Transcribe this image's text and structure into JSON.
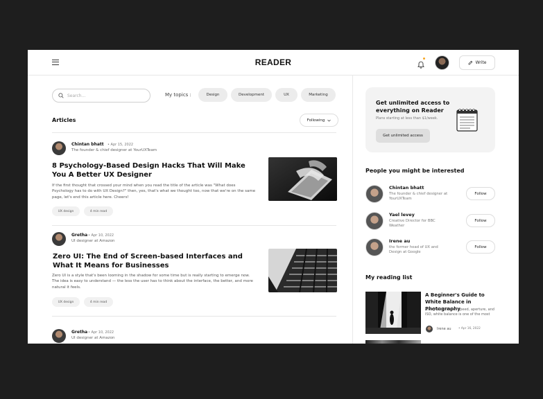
{
  "app": {
    "logo": "READER",
    "write_label": "Write"
  },
  "search": {
    "placeholder": "Search..."
  },
  "topics": {
    "label": "My topics :",
    "items": [
      "Design",
      "Development",
      "UX",
      "Marketing"
    ]
  },
  "articles_section": {
    "title": "Articles",
    "filter_label": "Following"
  },
  "articles": [
    {
      "author": "Chintan bhatt",
      "date": "Apr 15, 2022",
      "role": "The founder & chief designer at YourUXTeam",
      "title": "8 Psychology-Based Design Hacks That Will Make You A Better UX Designer",
      "excerpt": "If the first thought that crossed your mind when you read the title of the article was \"What does Psychology has to do with UX Design?\" then, yes, that's what we thought too, now that we're on the same page, let's end this article here. Cheers!",
      "tag": "UX design",
      "read_time": "4 min read"
    },
    {
      "author": "Gretha",
      "date": "Apr 10, 2022",
      "role": "UI designer at Amazon",
      "title": "Zero UI: The End of Screen-based Interfaces and What It Means for Businesses",
      "excerpt": "Zero UI is a style that's been looming in the shadow for some time but is really starting to emerge now. The idea is easy to understand — the less the user has to think about the interface, the better, and more natural it feels.",
      "tag": "UX design",
      "read_time": "4 min read"
    },
    {
      "author": "Gretha",
      "date": "Apr 10, 2022",
      "role": "UI designer at Amazon"
    }
  ],
  "promo": {
    "title": "Get unlimited access to everything on Reader",
    "subtitle": "Plans starting at less than $1/week.",
    "button": "Get unlimited access"
  },
  "people": {
    "title": "People you might be interested",
    "follow_label": "Follow",
    "items": [
      {
        "name": "Chintan bhatt",
        "desc": "The founder & chief designer at YourUXTeam"
      },
      {
        "name": "Yael levey",
        "desc": "Creative Director for BBC Weather"
      },
      {
        "name": "Irene au",
        "desc": "the former head of UX and Design at Google"
      }
    ]
  },
  "reading_list": {
    "title": "My reading list",
    "items": [
      {
        "title": "A Beginner's Guide to White Balance in Photography",
        "desc": "Along with shutter speed, aperture, and ISO, white balance is one of the most",
        "author": "Irene au",
        "date": "Apr 16, 2022"
      }
    ]
  }
}
